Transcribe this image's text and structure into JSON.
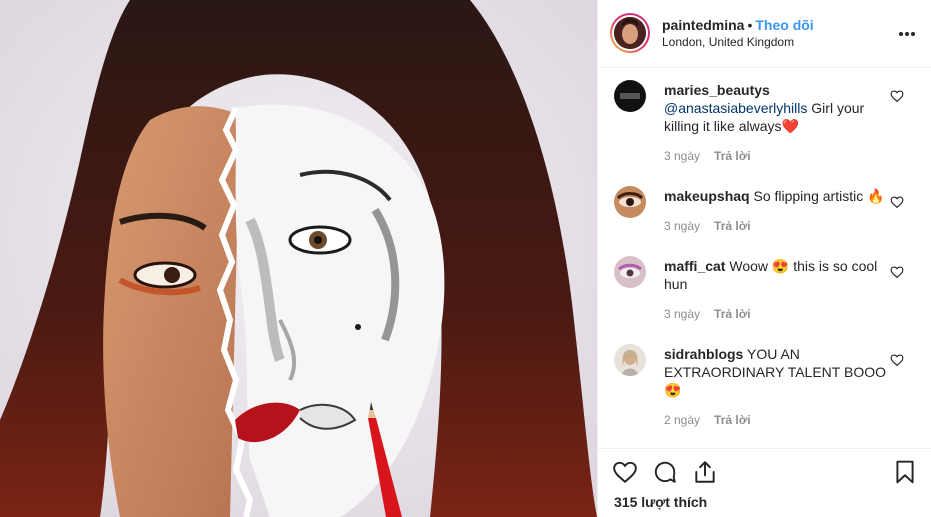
{
  "post": {
    "username": "paintedmina",
    "separator": "•",
    "follow_label": "Theo dõi",
    "location": "London, United Kingdom",
    "more_icon": "more-horizontal-icon"
  },
  "comments": [
    {
      "user": "maries_beautys",
      "mention": "@anastasiabeverlyhills",
      "text": " Girl your killing it like always❤️",
      "time": "3 ngày",
      "reply": "Trả lời"
    },
    {
      "user": "makeupshaq",
      "mention": "",
      "text": " So flipping artistic 🔥",
      "time": "3 ngày",
      "reply": "Trả lời"
    },
    {
      "user": "maffi_cat",
      "mention": "",
      "text": " Woow 😍 this is so cool hun",
      "time": "3 ngày",
      "reply": "Trả lời"
    },
    {
      "user": "sidrahblogs",
      "mention": "",
      "text": " YOU AN EXTRAORDINARY TALENT BOOO 😍",
      "time": "2 ngày",
      "reply": "Trả lời"
    }
  ],
  "actions": {
    "likes": "315 lượt thích",
    "icons": [
      "heart-icon",
      "comment-icon",
      "share-icon",
      "bookmark-icon"
    ]
  },
  "colors": {
    "accent": "#3897f0",
    "text": "#262626",
    "muted": "#8e8e8e",
    "border": "#efefef"
  }
}
